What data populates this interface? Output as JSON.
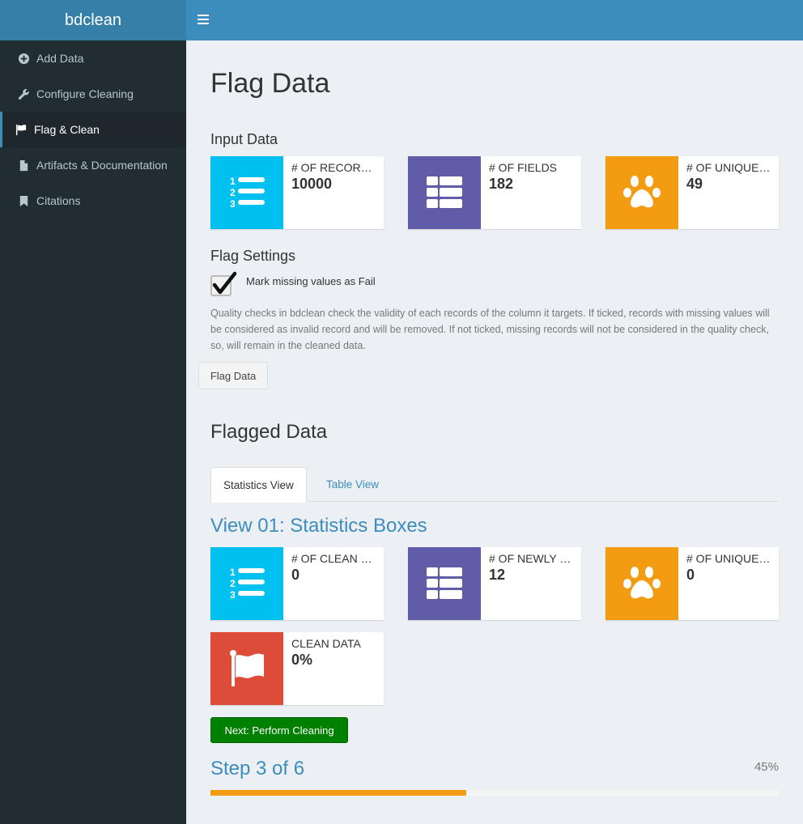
{
  "app": {
    "title": "bdclean"
  },
  "header": {
    "toggle_icon": "hamburger-icon"
  },
  "sidebar": {
    "items": [
      {
        "label": "Add Data",
        "icon": "plus-circle-icon",
        "active": false
      },
      {
        "label": "Configure Cleaning",
        "icon": "wrench-icon",
        "active": false
      },
      {
        "label": "Flag & Clean",
        "icon": "flag-icon",
        "active": true
      },
      {
        "label": "Artifacts & Documentation",
        "icon": "file-icon",
        "active": false
      },
      {
        "label": "Citations",
        "icon": "bookmark-icon",
        "active": false
      }
    ]
  },
  "main": {
    "page_title": "Flag Data",
    "input_data_title": "Input Data",
    "input_boxes": [
      {
        "label": "# of Records",
        "value": "10000",
        "icon": "list-ol-icon",
        "color": "#00c0ef"
      },
      {
        "label": "# of Fields",
        "value": "182",
        "icon": "table-icon",
        "color": "#605ca8"
      },
      {
        "label": "# of Unique Scientific Names",
        "value": "49",
        "icon": "paw-icon",
        "color": "#f39c12"
      }
    ],
    "flag_settings_title": "Flag Settings",
    "missing_checkbox": {
      "label": "Mark missing values as Fail",
      "checked": true
    },
    "help_text": "Quality checks in bdclean check the validity of each records of the column it targets. If ticked, records with missing values will be considered as invalid record and will be removed. If not ticked, missing records will not be considered in the quality check, so, will remain in the cleaned data.",
    "flag_button": "Flag Data",
    "flagged_title": "Flagged Data",
    "tabs": [
      {
        "label": "Statistics View",
        "active": true
      },
      {
        "label": "Table View",
        "active": false
      }
    ],
    "view_title": "View 01: Statistics Boxes",
    "stat_boxes": [
      {
        "label": "# of Clean Records",
        "value": "0",
        "icon": "list-ol-icon",
        "color": "#00c0ef"
      },
      {
        "label": "# of Newly Created Fields",
        "value": "12",
        "icon": "table-icon",
        "color": "#605ca8"
      },
      {
        "label": "# of Unique Scientific Names",
        "value": "0",
        "icon": "paw-icon",
        "color": "#f39c12"
      },
      {
        "label": "Clean Data",
        "value": "0%",
        "icon": "flag-icon",
        "color": "#dd4b39"
      }
    ],
    "next_button": "Next: Perform Cleaning",
    "step_title": "Step 3 of 6",
    "progress": {
      "percent_text": "45%",
      "percent": 45,
      "color": "#f39c12"
    }
  }
}
